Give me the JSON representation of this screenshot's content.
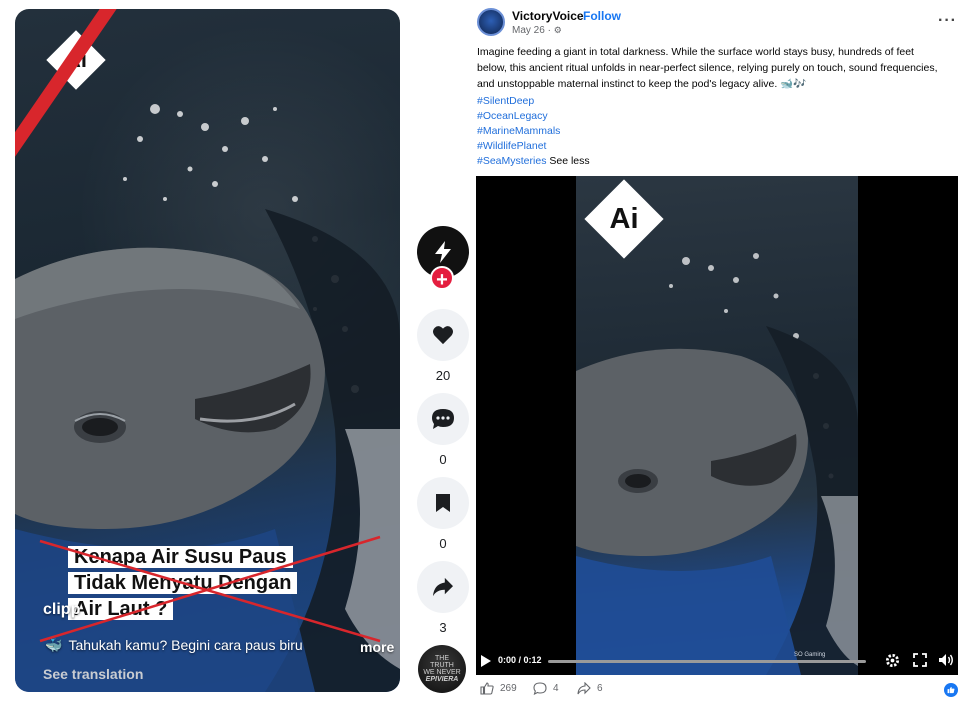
{
  "left_video": {
    "badge": "Ai",
    "caption_lines": [
      "Kenapa Air Susu Paus",
      "Tidak Menyatu Dengan",
      "Air Laut ?"
    ],
    "clip_label": "clipp",
    "description": "Tahukah kamu? Begini cara paus biru",
    "description_icon": "whale-emoji",
    "more": "more",
    "see_translation": "See translation"
  },
  "rail": {
    "likes": "20",
    "comments": "0",
    "saves": "0",
    "shares": "3",
    "avatar_text": [
      "THE",
      "TRUTH",
      "WE NEVER",
      "EPIVIERA"
    ]
  },
  "post": {
    "author": "VictoryVoice",
    "follow": "Follow",
    "separator": "·",
    "date": "May 26 ·",
    "body": "Imagine feeding a giant in total darkness. While the surface world stays busy, hundreds of feet below, this ancient ritual unfolds in near-perfect silence, relying purely on touch, sound frequencies, and unstoppable maternal instinct to keep the pod's legacy alive. 🐋🎶",
    "hashtags": [
      "#SilentDeep",
      "#OceanLegacy",
      "#MarineMammals",
      "#WildlifePlanet",
      "#SeaMysteries"
    ],
    "see_less": "See less",
    "video": {
      "badge": "Ai",
      "time": "0:00 / 0:12",
      "progress": 0,
      "watermark": "SO Gaming"
    },
    "likes": "269",
    "comments": "4",
    "shares": "6"
  },
  "colors": {
    "link_blue": "#216fdb",
    "brand_blue": "#1877f2",
    "cross_red": "#d8262c",
    "follow_plus_red": "#e41e3f"
  }
}
